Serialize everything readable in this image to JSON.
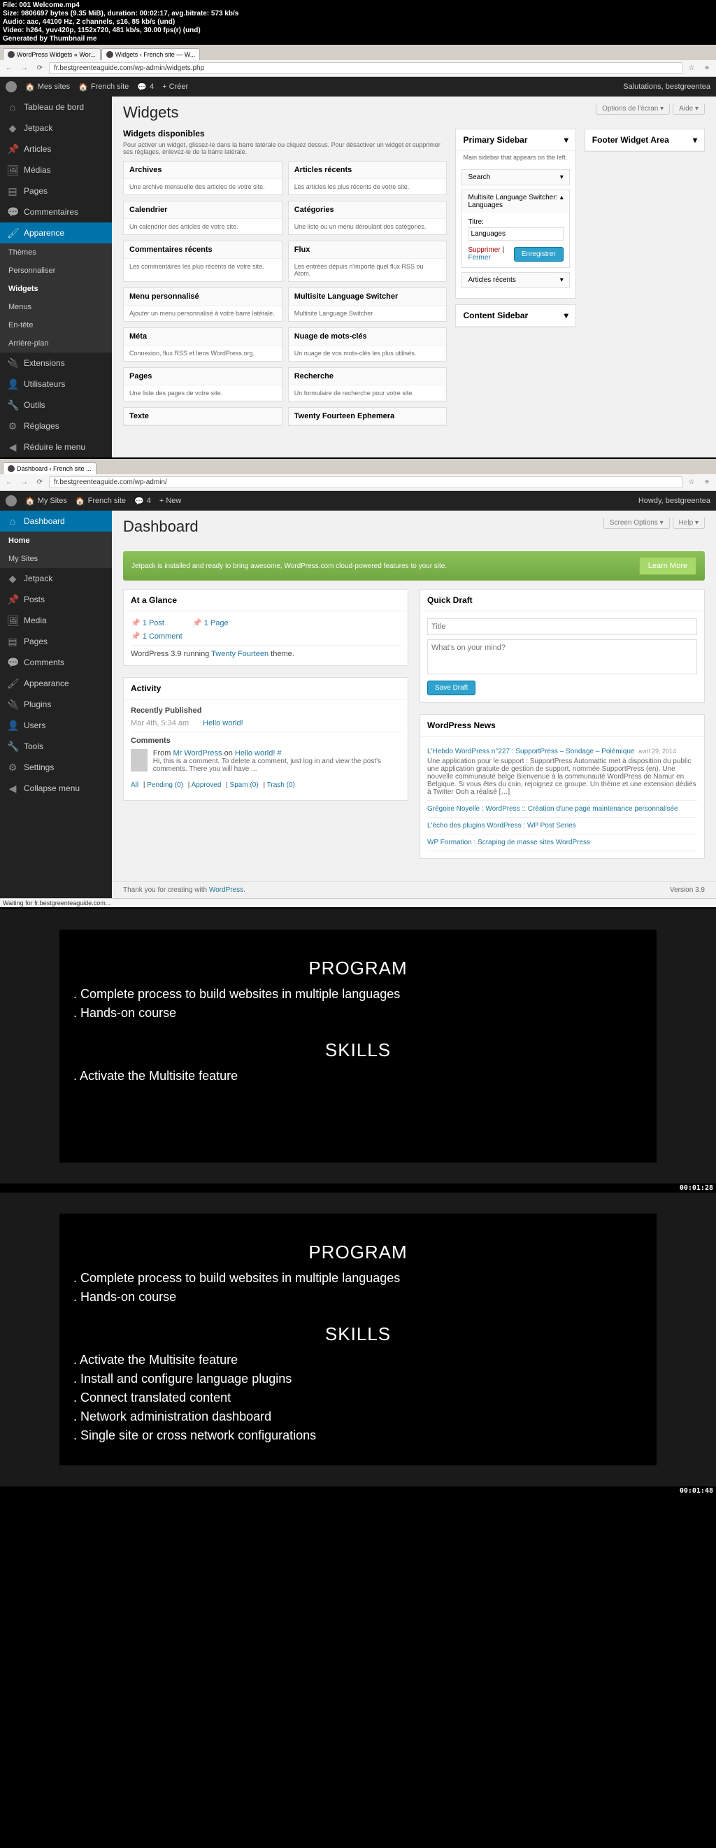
{
  "file_info": {
    "l1": "File: 001 Welcome.mp4",
    "l2": "Size: 9806697 bytes (9.35 MiB), duration: 00:02:17, avg.bitrate: 573 kb/s",
    "l3": "Audio: aac, 44100 Hz, 2 channels, s16, 85 kb/s (und)",
    "l4": "Video: h264, yuv420p, 1152x720, 481 kb/s, 30.00 fps(r) (und)",
    "l5": "Generated by Thumbnail me"
  },
  "screen1": {
    "tabs": {
      "t1": "WordPress Widgets « Wor...",
      "t2": "Widgets ‹ French site — W..."
    },
    "url": "fr.bestgreenteaguide.com/wp-admin/widgets.php",
    "wpbar": {
      "mysites": "Mes sites",
      "site": "French site",
      "comments": "4",
      "new": "+ Créer",
      "greeting": "Salutations, bestgreentea"
    },
    "menu": {
      "dashboard": "Tableau de bord",
      "jetpack": "Jetpack",
      "articles": "Articles",
      "medias": "Médias",
      "pages": "Pages",
      "comments": "Commentaires",
      "appearance": "Apparence",
      "themes": "Thèmes",
      "personalize": "Personnaliser",
      "widgets": "Widgets",
      "menus": "Menus",
      "header": "En-tête",
      "background": "Arrière-plan",
      "extensions": "Extensions",
      "users": "Utilisateurs",
      "tools": "Outils",
      "settings": "Réglages",
      "collapse": "Réduire le menu"
    },
    "page": {
      "title": "Widgets",
      "screen_opts": "Options de l'écran",
      "help": "Aide",
      "available": "Widgets disponibles",
      "available_desc": "Pour activer un widget, glissez-le dans la barre latérale ou cliquez dessus. Pour désactiver un widget et supprimer ses réglages, enlevez-le de la barre latérale."
    },
    "widgets": [
      {
        "t": "Archives",
        "d": "Une archive mensuelle des articles de votre site."
      },
      {
        "t": "Articles récents",
        "d": "Les articles les plus récents de votre site."
      },
      {
        "t": "Calendrier",
        "d": "Un calendrier des articles de votre site."
      },
      {
        "t": "Catégories",
        "d": "Une liste ou un menu déroulant des catégories."
      },
      {
        "t": "Commentaires récents",
        "d": "Les commentaires les plus récents de votre site."
      },
      {
        "t": "Flux",
        "d": "Les entrées depuis n'importe quel flux RSS ou Atom."
      },
      {
        "t": "Menu personnalisé",
        "d": "Ajouter un menu personnalisé à votre barre latérale."
      },
      {
        "t": "Multisite Language Switcher",
        "d": "Multisite Language Switcher"
      },
      {
        "t": "Méta",
        "d": "Connexion, flux RSS et liens WordPress.org."
      },
      {
        "t": "Nuage de mots-clés",
        "d": "Un nuage de vos mots-clés les plus utilisés."
      },
      {
        "t": "Pages",
        "d": "Une liste des pages de votre site."
      },
      {
        "t": "Recherche",
        "d": "Un formulaire de recherche pour votre site."
      },
      {
        "t": "Texte",
        "d": ""
      },
      {
        "t": "Twenty Fourteen Ephemera",
        "d": ""
      }
    ],
    "sidebars": {
      "primary": {
        "title": "Primary Sidebar",
        "desc": "Main sidebar that appears on the left.",
        "search": "Search",
        "mls": "Multisite Language Switcher: Languages",
        "title_label": "Titre:",
        "title_val": "Languages",
        "delete": "Supprimer",
        "close": "Fermer",
        "save": "Enregistrer",
        "recent": "Articles récents"
      },
      "content": "Content Sidebar",
      "footer": "Footer Widget Area"
    }
  },
  "screen2": {
    "tabs": {
      "t1": "Dashboard ‹ French site ..."
    },
    "url": "fr.bestgreenteaguide.com/wp-admin/",
    "wpbar": {
      "mysites": "My Sites",
      "site": "French site",
      "comments": "4",
      "new": "+ New",
      "greeting": "Howdy, bestgreentea"
    },
    "menu": {
      "dashboard": "Dashboard",
      "home": "Home",
      "mysites": "My Sites",
      "jetpack": "Jetpack",
      "posts": "Posts",
      "media": "Media",
      "pages": "Pages",
      "comments": "Comments",
      "appearance": "Appearance",
      "plugins": "Plugins",
      "users": "Users",
      "tools": "Tools",
      "settings": "Settings",
      "collapse": "Collapse menu"
    },
    "page": {
      "title": "Dashboard",
      "screen_opts": "Screen Options",
      "help": "Help"
    },
    "jetpack": {
      "msg": "Jetpack is installed and ready to bring awesome, WordPress.com cloud-powered features to your site.",
      "btn": "Learn More"
    },
    "glance": {
      "title": "At a Glance",
      "post": "1 Post",
      "page": "1 Page",
      "comment": "1 Comment",
      "running": "WordPress 3.9 running ",
      "theme": "Twenty Fourteen",
      "theme2": " theme."
    },
    "activity": {
      "title": "Activity",
      "recently": "Recently Published",
      "date": "Mar 4th, 5:34 am",
      "post": "Hello world!",
      "comments": "Comments",
      "from": "From ",
      "author": "Mr WordPress",
      "on": " on ",
      "link": "Hello world! #",
      "text": "Hi, this is a comment. To delete a comment, just log in and view the post's comments. There you will have ...",
      "filters": {
        "all": "All",
        "pending": "Pending (0)",
        "approved": "Approved",
        "spam": "Spam (0)",
        "trash": "Trash (0)"
      }
    },
    "quick": {
      "title": "Quick Draft",
      "ph_title": "Title",
      "ph_content": "What's on your mind?",
      "save": "Save Draft"
    },
    "news": {
      "title": "WordPress News",
      "items": [
        {
          "a": "L'Hebdo WordPress n°227 : SupportPress – Sondage – Polémique",
          "d": "avril 29, 2014",
          "x": "Une application pour le support : SupportPress Automattic met à disposition du public une application gratuite de gestion de support, nommée SupportPress (en). Une nouvelle communauté belge Bienvenue à la communauté WordPress de Namur en Belgique. Si vous êtes du coin, rejoignez ce groupe. Un thème et une extension dédiés à Twitter Ooh a réalisé […]"
        },
        {
          "a": "Grégoire Noyelle : WordPress :: Création d'une page maintenance personnalisée"
        },
        {
          "a": "L'écho des plugins WordPress : WP Post Series"
        },
        {
          "a": "WP Formation : Scraping de masse sites WordPress"
        }
      ]
    },
    "footer": {
      "thanks": "Thank you for creating with ",
      "wp": "WordPress",
      "ver": "Version 3.9"
    },
    "status": "Waiting for fr.bestgreenteaguide.com..."
  },
  "timecodes": {
    "t1": "00:01:28",
    "t2": "00:01:48"
  },
  "slide1": {
    "h1": "PROGRAM",
    "p1": "Complete process to build websites in multiple languages",
    "p2": "Hands-on course",
    "h2": "SKILLS",
    "s1": "Activate the Multisite feature"
  },
  "slide2": {
    "h1": "PROGRAM",
    "p1": "Complete process to build websites in multiple languages",
    "p2": "Hands-on course",
    "h2": "SKILLS",
    "s1": "Activate the Multisite feature",
    "s2": "Install and configure language plugins",
    "s3": "Connect translated content",
    "s4": "Network administration dashboard",
    "s5": "Single site or cross network configurations"
  }
}
